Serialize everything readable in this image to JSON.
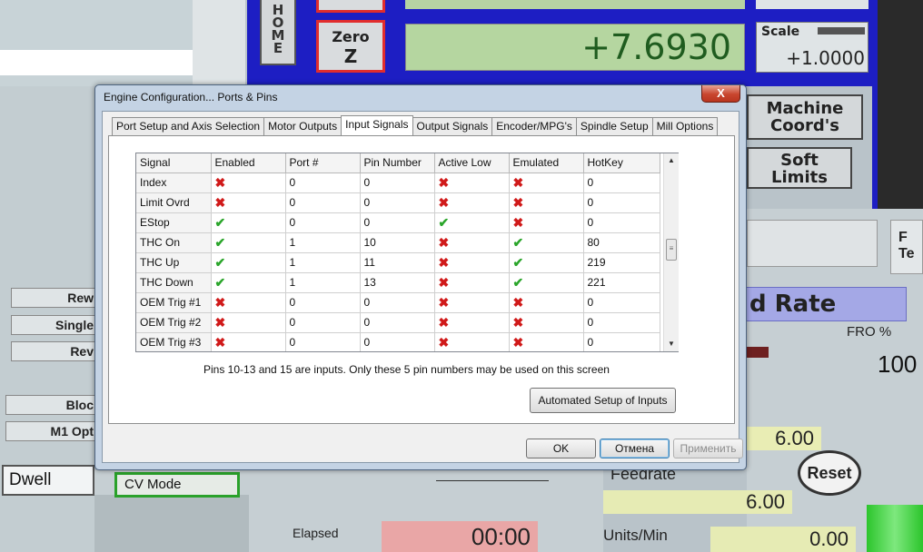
{
  "background": {
    "home_letters": [
      "H",
      "O",
      "M",
      "E"
    ],
    "zero_z": {
      "line1": "Zero",
      "line2": "Z"
    },
    "dro_value": "+7.6930",
    "scale": {
      "label": "Scale",
      "value": "+1.0000"
    },
    "machine_coords": {
      "line1": "Machine",
      "line2": "Coord's"
    },
    "soft_limits": {
      "line1": "Soft",
      "line2": "Limits"
    },
    "right_edge_btn": {
      "line1": "F",
      "line2": "Te"
    },
    "feed_rate_header": "d Rate",
    "fro_label": "FRO %",
    "fro_value": "100",
    "val_a": "6.00",
    "reset_label": "Reset",
    "feedrate_label": "Feedrate",
    "val_b": "6.00",
    "units_label": "Units/Min",
    "units_value": "0.00",
    "left_buttons": [
      "Rew",
      "Single",
      "Rev"
    ],
    "left_buttons2": [
      "Bloc",
      "M1 Opt"
    ],
    "dwell_label": "Dwell",
    "cv_mode_label": "CV Mode",
    "elapsed_label": "Elapsed",
    "elapsed_value": "00:00"
  },
  "dialog": {
    "title": "Engine Configuration... Ports & Pins",
    "close_label": "X",
    "tabs": [
      {
        "label": "Port Setup and Axis Selection",
        "active": false
      },
      {
        "label": "Motor Outputs",
        "active": false
      },
      {
        "label": "Input Signals",
        "active": true
      },
      {
        "label": "Output Signals",
        "active": false
      },
      {
        "label": "Encoder/MPG's",
        "active": false
      },
      {
        "label": "Spindle Setup",
        "active": false
      },
      {
        "label": "Mill Options",
        "active": false
      }
    ],
    "columns": [
      "Signal",
      "Enabled",
      "Port #",
      "Pin Number",
      "Active Low",
      "Emulated",
      "HotKey"
    ],
    "rows": [
      {
        "signal": "Index",
        "enabled": false,
        "port": "0",
        "pin": "0",
        "active_low": false,
        "emulated": false,
        "hotkey": "0"
      },
      {
        "signal": "Limit Ovrd",
        "enabled": false,
        "port": "0",
        "pin": "0",
        "active_low": false,
        "emulated": false,
        "hotkey": "0"
      },
      {
        "signal": "EStop",
        "enabled": true,
        "port": "0",
        "pin": "0",
        "active_low": true,
        "emulated": false,
        "hotkey": "0"
      },
      {
        "signal": "THC On",
        "enabled": true,
        "port": "1",
        "pin": "10",
        "active_low": false,
        "emulated": true,
        "hotkey": "80"
      },
      {
        "signal": "THC Up",
        "enabled": true,
        "port": "1",
        "pin": "11",
        "active_low": false,
        "emulated": true,
        "hotkey": "219"
      },
      {
        "signal": "THC Down",
        "enabled": true,
        "port": "1",
        "pin": "13",
        "active_low": false,
        "emulated": true,
        "hotkey": "221"
      },
      {
        "signal": "OEM Trig #1",
        "enabled": false,
        "port": "0",
        "pin": "0",
        "active_low": false,
        "emulated": false,
        "hotkey": "0"
      },
      {
        "signal": "OEM Trig #2",
        "enabled": false,
        "port": "0",
        "pin": "0",
        "active_low": false,
        "emulated": false,
        "hotkey": "0"
      },
      {
        "signal": "OEM Trig #3",
        "enabled": false,
        "port": "0",
        "pin": "0",
        "active_low": false,
        "emulated": false,
        "hotkey": "0"
      }
    ],
    "note": "Pins 10-13 and 15 are inputs. Only these 5 pin numbers may be used on this screen",
    "auto_setup_label": "Automated Setup of Inputs",
    "ok_label": "OK",
    "cancel_label": "Отмена",
    "apply_label": "Применить"
  },
  "colors": {
    "check": "#2aa52a",
    "cross": "#d01a1a",
    "accent_blue": "#1d1ec3"
  }
}
